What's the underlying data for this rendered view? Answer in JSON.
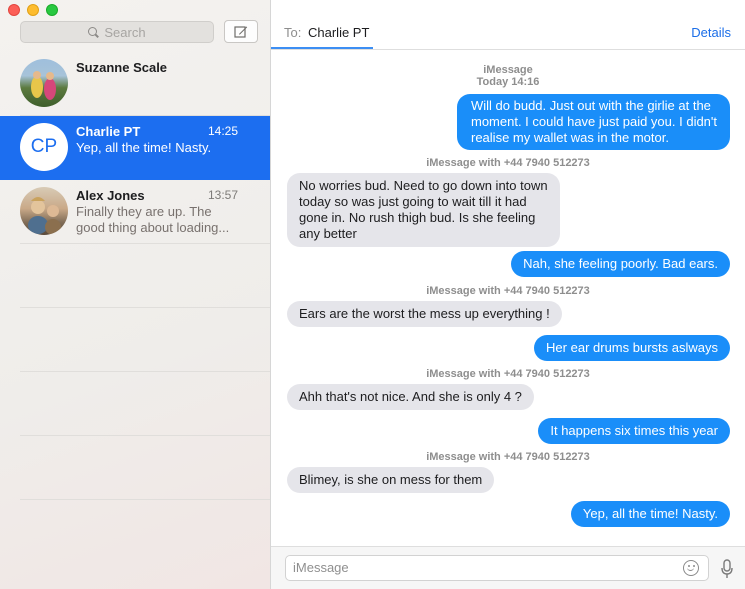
{
  "sidebar": {
    "search_placeholder": "Search",
    "conversations": [
      {
        "name": "Suzanne Scale",
        "time": "",
        "preview": "",
        "avatar": "photo"
      },
      {
        "name": "Charlie PT",
        "time": "14:25",
        "preview": "Yep, all the time!  Nasty.",
        "avatar_initials": "CP",
        "selected": true
      },
      {
        "name": "Alex Jones",
        "time": "13:57",
        "preview": "Finally they are up.  The good thing about loading...",
        "avatar": "photo"
      }
    ]
  },
  "header": {
    "to_label": "To:",
    "recipient": "Charlie PT",
    "details_label": "Details"
  },
  "thread": {
    "first_meta": {
      "service": "iMessage",
      "timestamp": "Today 14:16"
    },
    "sender_meta": "iMessage with +44 7940 512273",
    "messages": [
      {
        "from": "me",
        "text": "Will do budd.  Just out with the girlie at the moment.  I could have just paid you.  I didn't realise my wallet was in the motor."
      },
      {
        "from": "them",
        "text": "No worries bud. Need to go down into town today so was just going to wait till it had gone in. No rush thigh bud. Is she feeling any better"
      },
      {
        "from": "me",
        "text": "Nah, she feeling poorly.  Bad ears."
      },
      {
        "from": "them",
        "text": "Ears are the worst the mess up everything !"
      },
      {
        "from": "me",
        "text": "Her ear drums bursts aslways"
      },
      {
        "from": "them",
        "text": "Ahh that's not nice. And she is only 4 ?"
      },
      {
        "from": "me",
        "text": "It happens six times this year"
      },
      {
        "from": "them",
        "text": "Blimey, is she on mess for them"
      },
      {
        "from": "me",
        "text": "Yep, all the time!  Nasty."
      }
    ]
  },
  "composer": {
    "placeholder": "iMessage",
    "value": ""
  },
  "colors": {
    "selection_blue": "#1c6ef0",
    "sent_bubble": "#1a8ef9",
    "received_bubble": "#e5e5ea",
    "link_blue": "#1b6ee8"
  },
  "icons": [
    "close-icon",
    "minimize-icon",
    "maximize-icon",
    "search-icon",
    "compose-icon",
    "emoji-icon",
    "microphone-icon"
  ]
}
